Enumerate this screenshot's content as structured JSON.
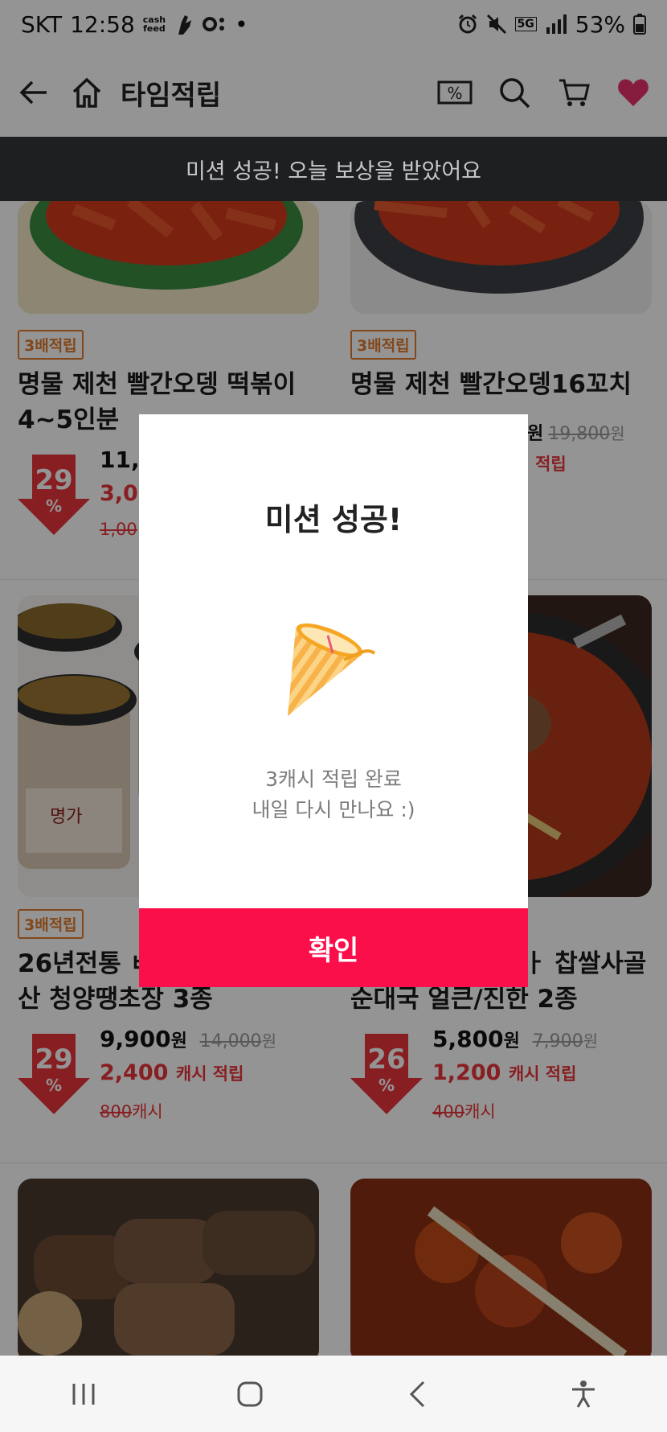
{
  "status_bar": {
    "carrier": "SKT",
    "time": "12:58",
    "cash_feed_label_1": "cash",
    "cash_feed_label_2": "feed",
    "network": "5G",
    "battery": "53%"
  },
  "header": {
    "title": "타임적립",
    "icons": [
      "back-arrow-icon",
      "home-icon",
      "coupon-icon",
      "search-icon",
      "cart-icon",
      "heart-icon"
    ],
    "coupon_symbol": "%",
    "heart_color": "#e8336b"
  },
  "toast": {
    "text": "미션 성공! 오늘 보상을 받았어요"
  },
  "products": [
    {
      "badge": "3배적립",
      "name_line1": "명물 제천 빨간오뎅 떡볶이",
      "name_line2": "4~5인분",
      "discount": "29",
      "discount_unit": "%",
      "price": "11,",
      "cash": "3,00",
      "prev": "1,00"
    },
    {
      "badge": "3배적립",
      "name_line1": "명물 제천 빨간오뎅16꼬치",
      "name_line2": "",
      "price_visible": "원",
      "original_price": "19,800",
      "original_unit": "원",
      "cash_label": "적립"
    },
    {
      "badge": "3배적립",
      "name_line1": "26년전통 ㅂ",
      "name_line2": "산 청양땡초장 3종",
      "discount": "29",
      "discount_unit": "%",
      "price": "9,900",
      "price_unit": "원",
      "original_price": "14,000",
      "original_unit": "원",
      "cash": "2,400",
      "cash_label": "캐시 적립",
      "prev": "800",
      "prev_unit": "캐시"
    },
    {
      "badge": "",
      "name_line1": "ㅏ 찹쌀사골",
      "name_line2": "순대국 얼큰/진한 2종",
      "discount": "26",
      "discount_unit": "%",
      "price": "5,800",
      "price_unit": "원",
      "original_price": "7,900",
      "original_unit": "원",
      "cash": "1,200",
      "cash_label": "캐시 적립",
      "prev": "400",
      "prev_unit": "캐시"
    }
  ],
  "dialog": {
    "title": "미션 성공!",
    "illustration": "party-popper-icon",
    "message_line1": "3캐시 적립 완료",
    "message_line2": "내일 다시 만나요 :)",
    "confirm_label": "확인",
    "confirm_color": "#fb0f4b"
  },
  "navbar": {
    "icons": [
      "recent-apps-icon",
      "home-circle-icon",
      "back-icon",
      "accessibility-icon"
    ]
  }
}
